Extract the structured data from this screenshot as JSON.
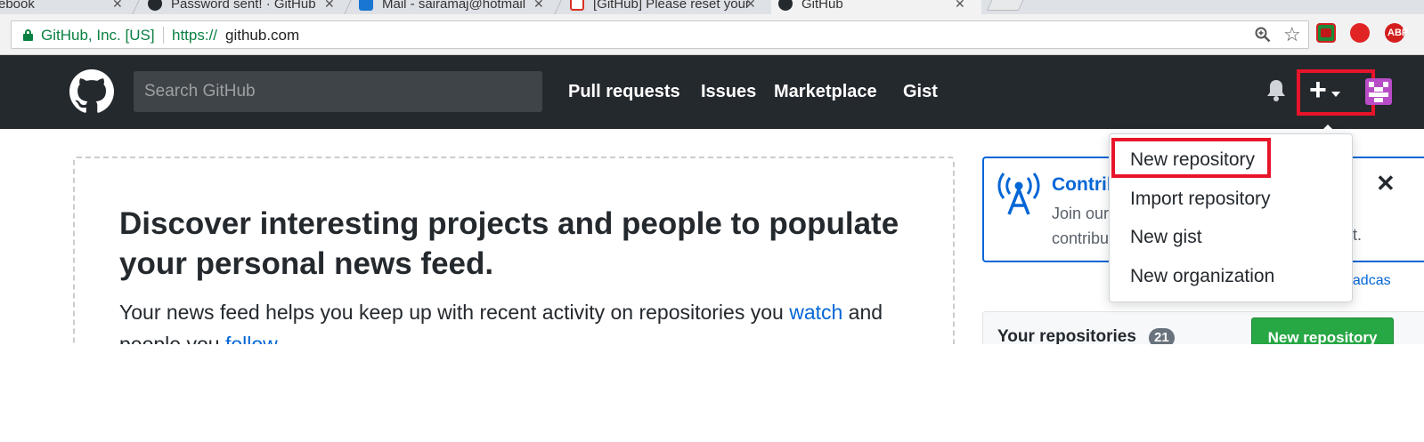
{
  "browser": {
    "tabs": [
      {
        "title": "ebook",
        "active": false
      },
      {
        "title": "Password sent! · GitHub",
        "active": false
      },
      {
        "title": "Mail - sairamaj@hotmail",
        "active": false
      },
      {
        "title": "[GitHub] Please reset your",
        "active": false
      },
      {
        "title": "GitHub",
        "active": true
      }
    ],
    "ev_certificate": "GitHub, Inc. [US]",
    "url_scheme": "https://",
    "url_host": "github.com",
    "extensions": {
      "abp_label": "ABP"
    }
  },
  "header": {
    "search_placeholder": "Search GitHub",
    "nav": [
      "Pull requests",
      "Issues",
      "Marketplace",
      "Gist"
    ],
    "plus_symbol": "+"
  },
  "create_menu": {
    "items": [
      "New repository",
      "Import repository",
      "New gist",
      "New organization"
    ]
  },
  "main": {
    "title": "Discover interesting projects and people to populate your personal news feed.",
    "text_before_watch": "Your news feed helps you keep up with recent activity on repositories you ",
    "watch_link": "watch",
    "text_between": " and people you ",
    "follow_link": "follow",
    "text_after": "."
  },
  "sidebar": {
    "broadcast_title": "Contrib",
    "broadcast_body_line1": "Join our",
    "broadcast_body_line2": "contribu",
    "broadcast_body_suffix": "t.",
    "broadcast_link": "oadcas",
    "close_symbol": "✕",
    "repos_title": "Your repositories",
    "repos_count": "21",
    "new_repo_button": "New repository"
  },
  "colors": {
    "header_bg": "#24292e",
    "link": "#0366d6",
    "success_button": "#28a745",
    "annotation_red": "#e8142a",
    "secure_green": "#0b8043"
  }
}
